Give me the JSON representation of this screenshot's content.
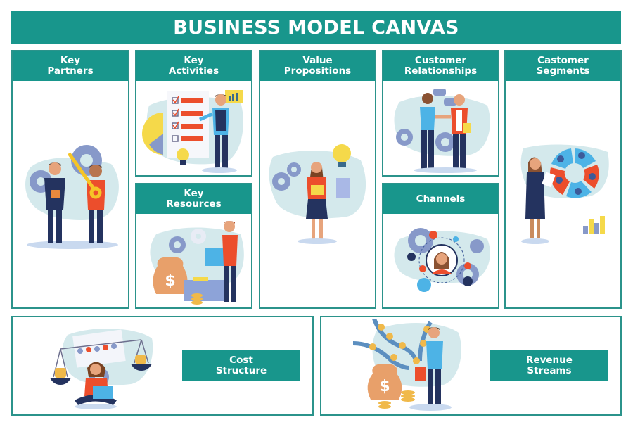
{
  "title": "BUSINESS MODEL CANVAS",
  "colors": {
    "primary": "#18968c",
    "border": "#2b938b",
    "background": "#ffffff"
  },
  "blocks": [
    {
      "id": "key-partners",
      "line1": "Key",
      "line2": "Partners",
      "illustration": "two-men-padlock-key-gears"
    },
    {
      "id": "key-activities",
      "line1": "Key",
      "line2": "Activities",
      "illustration": "man-checklist-lightbulb-chart"
    },
    {
      "id": "value-propositions",
      "line1": "Value",
      "line2": "Propositions",
      "illustration": "woman-box-gears-lightbulb-document"
    },
    {
      "id": "customer-relationships",
      "line1": "Customer",
      "line2": "Relationships",
      "illustration": "two-men-handshake-chat-bubbles"
    },
    {
      "id": "customer-segments",
      "line1": "Castomer",
      "line2": "Segments",
      "illustration": "woman-segment-wheel-bar-chart"
    },
    {
      "id": "key-resources",
      "line1": "Key",
      "line2": "Resources",
      "illustration": "man-cube-money-bag-box-coins"
    },
    {
      "id": "channels",
      "line1": "Channels",
      "line2": "",
      "illustration": "woman-avatar-network-gears"
    },
    {
      "id": "cost-structure",
      "line1": "Cost",
      "line2": "Structure",
      "illustration": "woman-laptop-scales-coins"
    },
    {
      "id": "revenue-streams",
      "line1": "Revenue",
      "line2": "Streams",
      "illustration": "man-bucket-coin-streams-money-bag"
    }
  ]
}
